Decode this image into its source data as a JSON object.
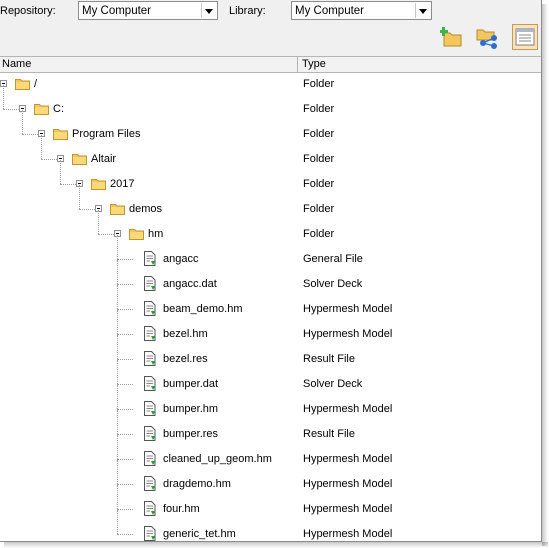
{
  "toolbar": {
    "repository_label": "Repository:",
    "repository_value": "My Computer",
    "library_label": "Library:",
    "library_value": "My Computer"
  },
  "columns": {
    "name": "Name",
    "type": "Type"
  },
  "colors": {
    "folder": "#f5c75a",
    "file_accent": "#2a9d3a",
    "selected_button": "#f7e3bf"
  },
  "tree": [
    {
      "name": "/",
      "type": "Folder",
      "kind": "folder",
      "depth": 0
    },
    {
      "name": "C:",
      "type": "Folder",
      "kind": "folder",
      "depth": 1
    },
    {
      "name": "Program Files",
      "type": "Folder",
      "kind": "folder",
      "depth": 2
    },
    {
      "name": "Altair",
      "type": "Folder",
      "kind": "folder",
      "depth": 3
    },
    {
      "name": "2017",
      "type": "Folder",
      "kind": "folder",
      "depth": 4
    },
    {
      "name": "demos",
      "type": "Folder",
      "kind": "folder",
      "depth": 5
    },
    {
      "name": "hm",
      "type": "Folder",
      "kind": "folder",
      "depth": 6
    },
    {
      "name": "angacc",
      "type": "General File",
      "kind": "file",
      "depth": 7
    },
    {
      "name": "angacc.dat",
      "type": "Solver Deck",
      "kind": "file",
      "depth": 7
    },
    {
      "name": "beam_demo.hm",
      "type": "Hypermesh Model",
      "kind": "file",
      "depth": 7
    },
    {
      "name": "bezel.hm",
      "type": "Hypermesh Model",
      "kind": "file",
      "depth": 7
    },
    {
      "name": "bezel.res",
      "type": "Result File",
      "kind": "file",
      "depth": 7
    },
    {
      "name": "bumper.dat",
      "type": "Solver Deck",
      "kind": "file",
      "depth": 7
    },
    {
      "name": "bumper.hm",
      "type": "Hypermesh Model",
      "kind": "file",
      "depth": 7
    },
    {
      "name": "bumper.res",
      "type": "Result File",
      "kind": "file",
      "depth": 7
    },
    {
      "name": "cleaned_up_geom.hm",
      "type": "Hypermesh Model",
      "kind": "file",
      "depth": 7
    },
    {
      "name": "dragdemo.hm",
      "type": "Hypermesh Model",
      "kind": "file",
      "depth": 7
    },
    {
      "name": "four.hm",
      "type": "Hypermesh Model",
      "kind": "file",
      "depth": 7
    },
    {
      "name": "generic_tet.hm",
      "type": "Hypermesh Model",
      "kind": "file",
      "depth": 7
    }
  ]
}
